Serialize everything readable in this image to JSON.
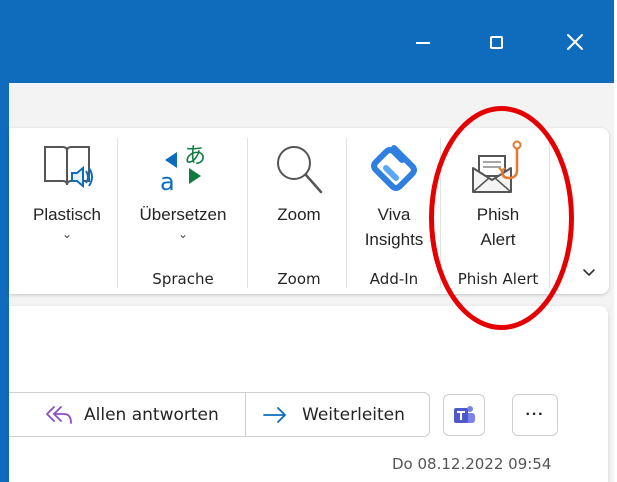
{
  "window": {
    "minimize_icon": "minimize-icon",
    "maximize_icon": "maximize-icon",
    "close_icon": "close-icon",
    "accent_color": "#0f6cbd"
  },
  "ribbon": {
    "buttons": [
      {
        "label": "Plastisch",
        "icon": "immersive-reader-icon",
        "has_dropdown": true
      },
      {
        "label": "Übersetzen",
        "icon": "translate-icon",
        "has_dropdown": true
      },
      {
        "label": "Zoom",
        "icon": "zoom-icon",
        "has_dropdown": false
      },
      {
        "label_line1": "Viva",
        "label_line2": "Insights",
        "icon": "viva-insights-icon",
        "has_dropdown": false
      },
      {
        "label_line1": "Phish",
        "label_line2": "Alert",
        "icon": "phish-alert-icon",
        "has_dropdown": false
      }
    ],
    "groups": [
      {
        "label": "Sprache"
      },
      {
        "label": "Zoom"
      },
      {
        "label": "Add-In"
      },
      {
        "label": "Phish Alert"
      }
    ],
    "dropdown_chevron": "⌄",
    "collapse_icon": "chevron-down-icon"
  },
  "message": {
    "reply_all_label": "Allen antworten",
    "forward_label": "Weiterleiten",
    "teams_icon": "teams-icon",
    "more_label": "···",
    "timestamp": "Do 08.12.2022 09:54"
  },
  "annotation": {
    "highlight_color": "#e50000"
  }
}
